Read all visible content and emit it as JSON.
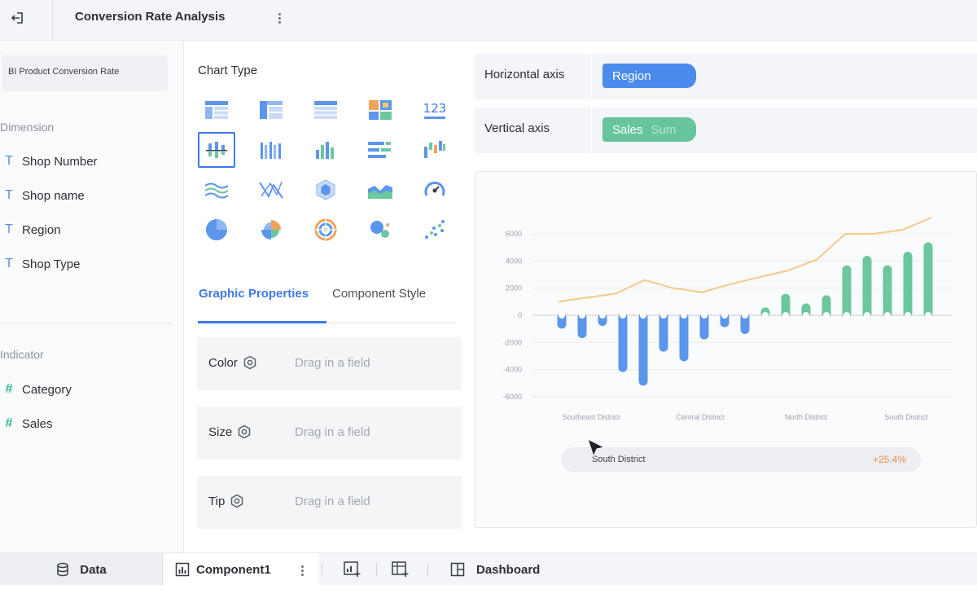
{
  "header": {
    "title": "Conversion Rate Analysis"
  },
  "left_panel": {
    "dataset_name": "BI Product Conversion Rate",
    "dimension_label": "Dimension",
    "dimensions": [
      "Shop Number",
      "Shop name",
      "Region",
      "Shop Type"
    ],
    "indicator_label": "Indicator",
    "indicators": [
      "Category",
      "Sales"
    ]
  },
  "middle_panel": {
    "chart_type_label": "Chart Type",
    "chart_types": [
      "table-icon",
      "cross-table-icon",
      "detail-table-icon",
      "color-block-icon",
      "kpi-number-icon",
      "grouped-bar-icon",
      "multi-column-icon",
      "column-chart-icon",
      "horizontal-bar-icon",
      "waterfall-icon",
      "wave-line-icon",
      "radar-line-icon",
      "polygon-icon",
      "area-chart-icon",
      "gauge-icon",
      "pie-chart-icon",
      "rose-pie-icon",
      "ring-target-icon",
      "bubble-icon",
      "scatter-icon"
    ],
    "selected_chart_type": "grouped-bar-icon",
    "tabs": {
      "graphic_properties": "Graphic Properties",
      "component_style": "Component Style"
    },
    "properties": [
      {
        "label": "Color",
        "placeholder": "Drag in a field"
      },
      {
        "label": "Size",
        "placeholder": "Drag in a field"
      },
      {
        "label": "Tip",
        "placeholder": "Drag in a field"
      }
    ]
  },
  "axes": {
    "horizontal_label": "Horizontal axis",
    "horizontal_field": "Region",
    "vertical_label": "Vertical axis",
    "vertical_field": "Sales",
    "vertical_agg": "Sum"
  },
  "chart_data": {
    "type": "bar",
    "y_ticks": [
      "6000",
      "4000",
      "2000",
      "0",
      "-2000",
      "-4000",
      "-6000"
    ],
    "ylim": [
      -6000,
      6000
    ],
    "x_tick_labels": [
      "Southeast District",
      "Central District",
      "North District",
      "South District"
    ],
    "bars": [
      -800,
      -1500,
      -600,
      -4000,
      -5000,
      -2500,
      -3200,
      -1600,
      -700,
      -1200,
      400,
      1400,
      700,
      1300,
      3500,
      4200,
      3500,
      4500,
      5200
    ],
    "line": [
      1000,
      1300,
      1600,
      2600,
      2000,
      1700,
      2300,
      2800,
      3300,
      4100,
      6000,
      6000,
      6300,
      7200
    ],
    "colors": {
      "negative": "#5b95ec",
      "positive": "#6cc79e",
      "line": "#f6c88a"
    },
    "tooltip": {
      "label": "South District",
      "value": "+25.4%"
    }
  },
  "bottom_bar": {
    "data_tab": "Data",
    "component_tab": "Component1",
    "dashboard_tab": "Dashboard"
  }
}
